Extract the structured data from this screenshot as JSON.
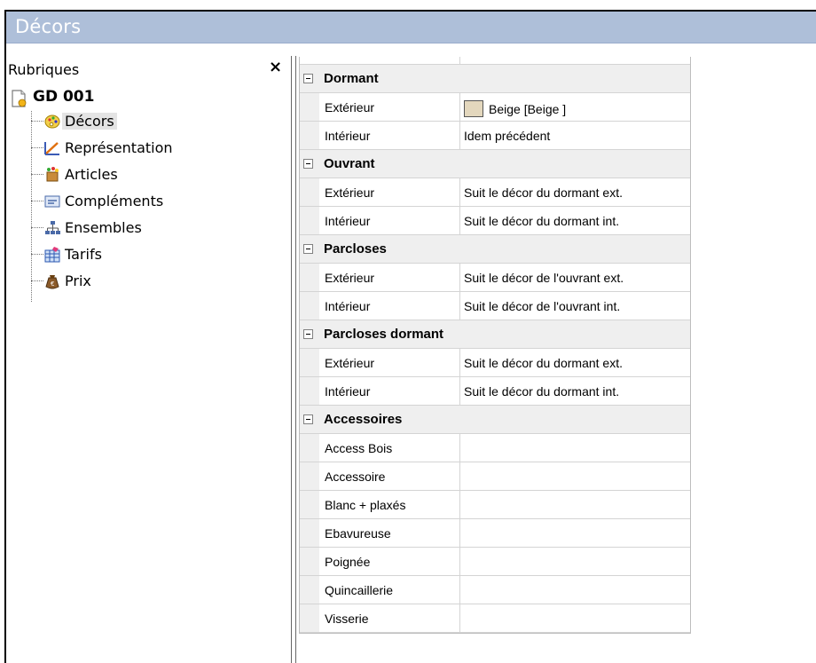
{
  "window": {
    "title": "Décors"
  },
  "sidebar": {
    "header": "Rubriques",
    "close_glyph": "×",
    "root": {
      "label": "GD 001",
      "icon": "document-icon"
    },
    "items": [
      {
        "label": "Décors",
        "icon": "palette-icon",
        "selected": true
      },
      {
        "label": "Représentation",
        "icon": "drawing-icon",
        "selected": false
      },
      {
        "label": "Articles",
        "icon": "articles-icon",
        "selected": false
      },
      {
        "label": "Compléments",
        "icon": "complements-icon",
        "selected": false
      },
      {
        "label": "Ensembles",
        "icon": "hierarchy-icon",
        "selected": false
      },
      {
        "label": "Tarifs",
        "icon": "price-table-icon",
        "selected": false
      },
      {
        "label": "Prix",
        "icon": "money-bag-icon",
        "selected": false
      }
    ]
  },
  "grid": {
    "rows": [
      {
        "type": "cat",
        "label": "Dormant"
      },
      {
        "type": "prop",
        "name": "Extérieur",
        "value": "Beige [Beige ]",
        "swatch": "#e3d7bd"
      },
      {
        "type": "prop",
        "name": "Intérieur",
        "value": "Idem précédent"
      },
      {
        "type": "cat",
        "label": "Ouvrant"
      },
      {
        "type": "prop",
        "name": "Extérieur",
        "value": "Suit le décor du dormant ext."
      },
      {
        "type": "prop",
        "name": "Intérieur",
        "value": "Suit le décor du dormant int."
      },
      {
        "type": "cat",
        "label": "Parcloses"
      },
      {
        "type": "prop",
        "name": "Extérieur",
        "value": "Suit le décor de l'ouvrant ext."
      },
      {
        "type": "prop",
        "name": "Intérieur",
        "value": "Suit le décor de l'ouvrant int."
      },
      {
        "type": "cat",
        "label": "Parcloses dormant"
      },
      {
        "type": "prop",
        "name": "Extérieur",
        "value": "Suit le décor du dormant ext."
      },
      {
        "type": "prop",
        "name": "Intérieur",
        "value": "Suit le décor du dormant int."
      },
      {
        "type": "cat",
        "label": "Accessoires"
      },
      {
        "type": "prop",
        "name": "Access Bois",
        "value": ""
      },
      {
        "type": "prop",
        "name": "Accessoire",
        "value": ""
      },
      {
        "type": "prop",
        "name": "Blanc + plaxés",
        "value": ""
      },
      {
        "type": "prop",
        "name": "Ebavureuse",
        "value": ""
      },
      {
        "type": "prop",
        "name": "Poignée",
        "value": ""
      },
      {
        "type": "prop",
        "name": "Quincaillerie",
        "value": ""
      },
      {
        "type": "prop",
        "name": "Visserie",
        "value": ""
      }
    ]
  }
}
